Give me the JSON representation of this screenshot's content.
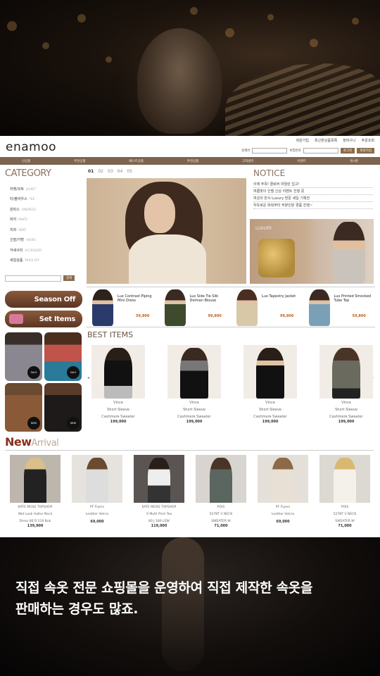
{
  "site": {
    "logo": "enamoo",
    "top_links": [
      "회원가입",
      "최근본상품목록",
      "장바구니",
      "주문조회"
    ],
    "search_label": "검색어",
    "search_label2": "비밀번호",
    "login_button": "로그인",
    "join_button": "회원가입"
  },
  "gnb": [
    "신상품",
    "추천상품",
    "베스트상품",
    "추천상품",
    "고객센터",
    "이벤트",
    "게시판"
  ],
  "category": {
    "title": "CATEGORY",
    "items": [
      {
        "label": "자켓/코트",
        "sub": "JACKET"
      },
      {
        "label": "티/블라우스",
        "sub": "TEE"
      },
      {
        "label": "원피스",
        "sub": "ONEPIECE"
      },
      {
        "label": "바지",
        "sub": "PANTS"
      },
      {
        "label": "치마",
        "sub": "SKIRT"
      },
      {
        "label": "신발/가방",
        "sub": "SHOES"
      },
      {
        "label": "악세사리",
        "sub": "ACCESSORY"
      },
      {
        "label": "세일상품",
        "sub": "PRICE OFF"
      }
    ],
    "search_button": "검색"
  },
  "side_buttons": {
    "season_off": "Season Off",
    "set_items": "Set Items"
  },
  "thumb_badges": [
    "SALE",
    "SALE",
    "NEW",
    "NEW"
  ],
  "pager": [
    "01",
    "02",
    "03",
    "04",
    "05"
  ],
  "notice": {
    "title": "NOTICE",
    "items": [
      "이에 주목! 클로버 마릴린 입고!",
      "여름맞이 인텔 신상 이벤트 진행 중",
      "여성의 만사 Luxury 방문 세일 기획전",
      "자유로운 파워부터 부분인분 경품 진행~"
    ],
    "banner_text": "LUXURY"
  },
  "strip": [
    {
      "name": "Lux Contrast Piping Mini Dress",
      "price": "59,800"
    },
    {
      "name": "Lux Side Tie Silk Dolman Blouse",
      "price": "99,800"
    },
    {
      "name": "Lux Tapestry Jacket",
      "price": "99,800"
    },
    {
      "name": "Lux Printed Smocked Tube Top",
      "price": "59,800"
    }
  ],
  "best": {
    "title": "BEST ITEMS",
    "items": [
      {
        "line1": "Vince",
        "line2": "Short Sleeve",
        "line3": "Cashmere Sweater",
        "price": "199,000"
      },
      {
        "line1": "Vince",
        "line2": "Short Sleeve",
        "line3": "Cashmere Sweater",
        "price": "199,000"
      },
      {
        "line1": "Vince",
        "line2": "Short Sleeve",
        "line3": "Cashmere Sweater",
        "price": "199,000"
      },
      {
        "line1": "Vince",
        "line2": "Short Sleeve",
        "line3": "Cashmere Sweater",
        "price": "199,000"
      }
    ]
  },
  "new_arrival": {
    "title_bold": "New",
    "title_thin": "Arrival",
    "items": [
      {
        "line1": "KATE MOSS TOPSHOP",
        "line2": "Wet Look Halter Neck",
        "line3": "Dress 80 D 210 Buk",
        "price": "139,000"
      },
      {
        "line1": "PF Flyers",
        "line2": "Leather Velcro",
        "line3": "",
        "price": "69,000"
      },
      {
        "line1": "KATE MOSS TOPSHOP",
        "line2": "X Multi Print Tea",
        "line3": "80 J 180 LEW",
        "price": "119,000"
      },
      {
        "line1": "POIS",
        "line2": "527BT V NECK",
        "line3": "SWEATER W",
        "price": "71,000"
      },
      {
        "line1": "PF Flyers",
        "line2": "Leather Velcro",
        "line3": "",
        "price": "69,000"
      },
      {
        "line1": "POIS",
        "line2": "527BT V NECK",
        "line3": "SWEATER W",
        "price": "71,000"
      }
    ]
  },
  "caption": {
    "line1": "직접 속옷 전문 쇼핑몰을 운영하여 직접 제작한 속옷을",
    "line2": "판매하는 경우도 많죠."
  },
  "colors": {
    "brand_brown": "#7d6450",
    "accent_red": "#8a2f1e",
    "price_orange": "#c06020"
  }
}
